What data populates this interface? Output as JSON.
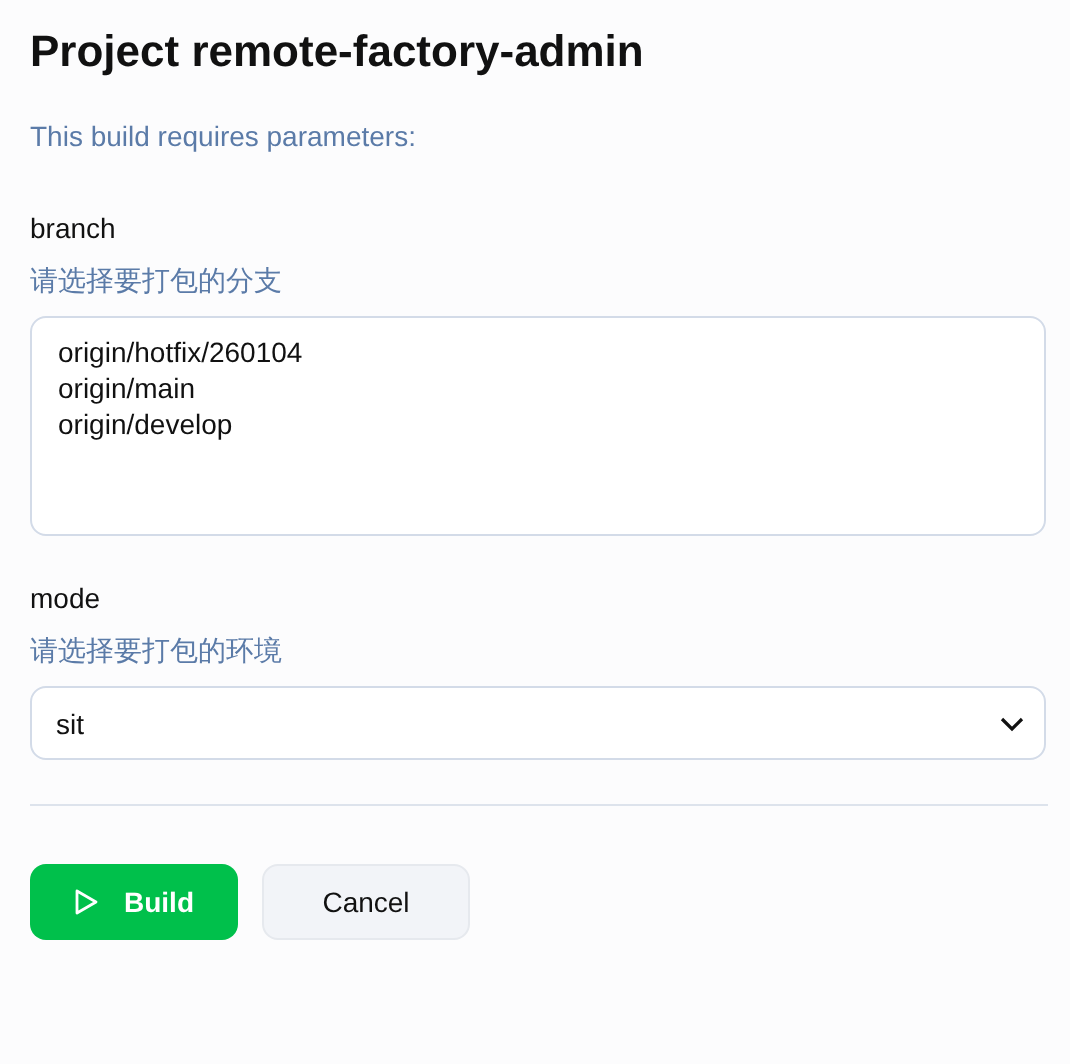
{
  "title": "Project remote-factory-admin",
  "intro": "This build requires parameters:",
  "parameters": [
    {
      "kind": "textarea",
      "name": "branch",
      "description": "请选择要打包的分支",
      "value": [
        "origin/hotfix/260104",
        "origin/main",
        "origin/develop"
      ]
    },
    {
      "kind": "select",
      "name": "mode",
      "description": "请选择要打包的环境",
      "value": "sit"
    }
  ],
  "buttons": [
    {
      "label": "Build",
      "kind": "primary"
    },
    {
      "label": "Cancel",
      "kind": "secondary"
    }
  ]
}
